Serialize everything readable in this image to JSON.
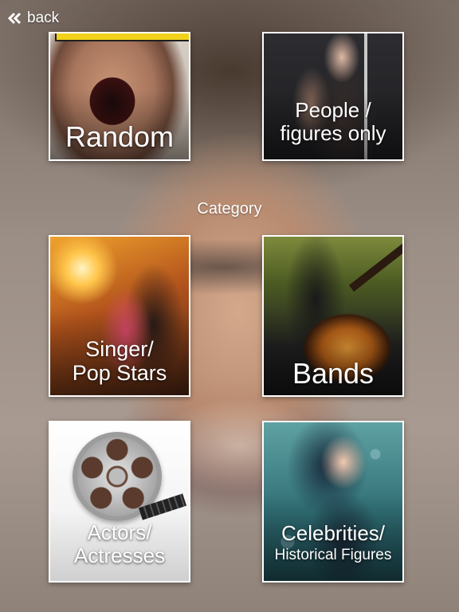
{
  "nav": {
    "back_label": "back"
  },
  "heading": {
    "category_label": "Category"
  },
  "tiles": [
    {
      "id": "random",
      "lines": [
        "Random"
      ]
    },
    {
      "id": "people",
      "lines": [
        "People /",
        "figures only"
      ]
    },
    {
      "id": "singer",
      "lines": [
        "Singer/",
        "Pop Stars"
      ]
    },
    {
      "id": "bands",
      "lines": [
        "Bands"
      ]
    },
    {
      "id": "actors",
      "lines": [
        "Actors/",
        "Actresses"
      ]
    },
    {
      "id": "celebs",
      "lines": [
        "Celebrities/",
        "Historical Figures"
      ]
    }
  ],
  "colors": {
    "text": "#ffffff",
    "tile_border": "#ffffff",
    "accent_yellow": "#f2d21b"
  },
  "icons": {
    "back": "double-chevron-left-icon"
  }
}
